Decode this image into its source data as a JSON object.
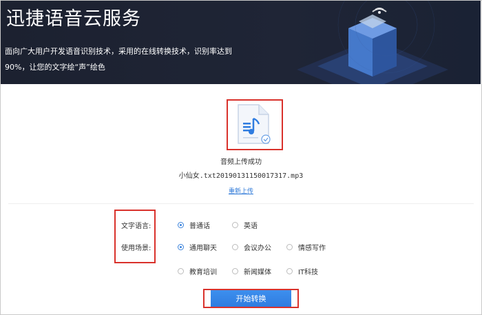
{
  "hero": {
    "title": "迅捷语音云服务",
    "desc_line1": "面向广大用户开发语音识别技术，采用的在线转换技术，识别率达到",
    "desc_line2": "90%，让您的文字绘“声”绘色"
  },
  "upload": {
    "status": "音频上传成功",
    "file_name": "小仙女.txt20190131150017317.mp3",
    "reupload_label": "重新上传",
    "icon": "music-file-icon"
  },
  "settings": {
    "language_label": "文字语言:",
    "languages": [
      {
        "label": "普通话",
        "selected": true
      },
      {
        "label": "英语",
        "selected": false
      }
    ],
    "scene_label": "使用场景:",
    "scenes": [
      {
        "label": "通用聊天",
        "selected": true
      },
      {
        "label": "会议办公",
        "selected": false
      },
      {
        "label": "情感写作",
        "selected": false
      },
      {
        "label": "教育培训",
        "selected": false
      },
      {
        "label": "新闻媒体",
        "selected": false
      },
      {
        "label": "IT科技",
        "selected": false
      }
    ]
  },
  "start_button": {
    "label": "开始转换"
  },
  "colors": {
    "accent": "#2f7ce0",
    "highlight": "#d9312b",
    "hero_bg": "#1c2130"
  }
}
